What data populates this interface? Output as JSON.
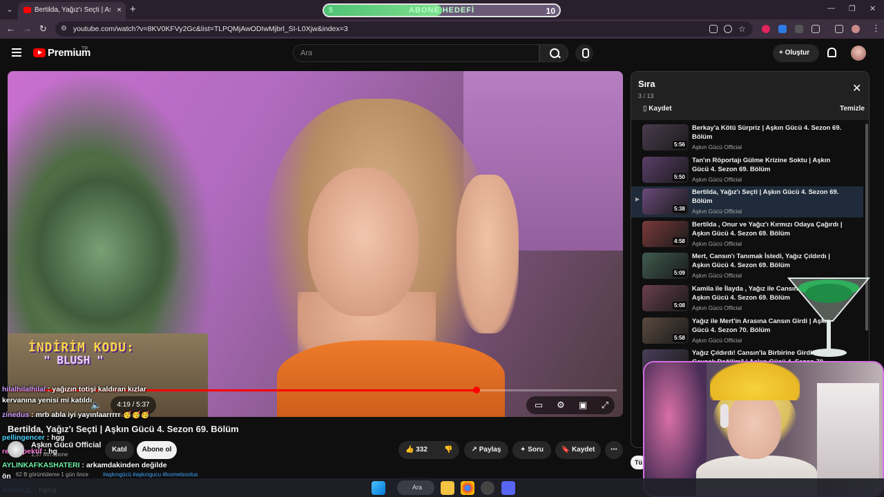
{
  "browser": {
    "tab_title": "Bertilda, Yağız'ı Seçti | Aşkın Gücü 4. Sezon 69. Bölüm",
    "url": "youtube.com/watch?v=8KV0KFVy2Gc&list=TLPQMjAwODIwMjbrl_SI-L0Xjw&index=3",
    "goal": {
      "left": "5",
      "label": "ABONE HEDEFİ",
      "right": "10",
      "progress_fraction": 0.5
    }
  },
  "header": {
    "brand": "Premium",
    "country": "TR",
    "search_placeholder": "Ara",
    "create_label": "Oluştur"
  },
  "video": {
    "promo_line1": "İNDİRİM KODU:",
    "promo_line2": "\" BLUSH \"",
    "time": "4:19 / 5:37",
    "progress_fraction": 0.77,
    "title": "Bertilda, Yağız'ı Seçti | Aşkın Gücü 4. Sezon 69. Bölüm",
    "channel": "Aşkın Gücü Official",
    "subs": "1,37 Mn abone",
    "join_label": "Katıl",
    "subscribe_label": "Abone ol",
    "likes": "332",
    "share_label": "Paylaş",
    "ask_label": "Soru",
    "save_label": "Kaydet",
    "desc_views": "62 B görüntüleme  1 gün önce",
    "desc_tags": "#aşkıngücü #aşkıngucu #kısmetsoolus"
  },
  "chat": [
    {
      "user": "hilalhilalhilal",
      "msg": "yağızın totişi kaldıran kızlar",
      "color": "#c99bff"
    },
    {
      "user": "",
      "msg": "kervanına yenisi mi katıldı",
      "color": "#ffffff"
    },
    {
      "user": "zinedus",
      "msg": "mrb abla iyi yayınlaarrrrr 🥳🥳🥳",
      "color": "#c99bff"
    },
    {
      "user": "pellingencer",
      "msg": "hgg",
      "color": "#4fd3ff"
    },
    {
      "user": "retrospektif",
      "msg": "hg",
      "color": "#ff7ad9"
    },
    {
      "user": "AYLINKAFKASHATERI",
      "msg": "arkamdakinden değilde",
      "color": "#6ff0a8"
    },
    {
      "user": "",
      "msg": "ön",
      "color": "#ffffff"
    },
    {
      "user": "BleibtQL",
      "msg": "hghg",
      "color": "#4fa0ff"
    }
  ],
  "playlist": {
    "title": "Sıra",
    "count": "3 / 13",
    "save_label": "Kaydet",
    "clear_label": "Temizle",
    "items": [
      {
        "title": "Berkay'a Kötü Sürpriz | Aşkın Gücü 4. Sezon 69. Bölüm",
        "channel": "Aşkın Gücü Official",
        "duration": "5:56",
        "thumb": "#4a3c4e"
      },
      {
        "title": "Tan'ın Röportajı Gülme Krizine Soktu | Aşkın Gücü 4. Sezon 69. Bölüm",
        "channel": "Aşkın Gücü Official",
        "duration": "5:50",
        "thumb": "#5b3f6a"
      },
      {
        "title": "Bertilda, Yağız'ı Seçti | Aşkın Gücü 4. Sezon 69. Bölüm",
        "channel": "Aşkın Gücü Official",
        "duration": "5:38",
        "thumb": "#6a4a7a"
      },
      {
        "title": "Bertilda , Onur ve Yağız'ı Kırmızı Odaya Çağırdı | Aşkın Gücü 4. Sezon 69. Bölüm",
        "channel": "Aşkın Gücü Official",
        "duration": "4:58",
        "thumb": "#7a3a3a"
      },
      {
        "title": "Mert, Cansın'ı Tanımak İstedi, Yağız Çıldırdı | Aşkın Gücü 4. Sezon 69. Bölüm",
        "channel": "Aşkın Gücü Official",
        "duration": "5:09",
        "thumb": "#3f5c50"
      },
      {
        "title": "Kamila ile İlayda , Yağız ile Cansın İçin Kavga | Aşkın Gücü 4. Sezon 69. Bölüm",
        "channel": "Aşkın Gücü Official",
        "duration": "5:08",
        "thumb": "#6a3f4e"
      },
      {
        "title": "Yağız ile Mert'in Arasına Cansın Girdi | Aşkın Gücü 4. Sezon 70. Bölüm",
        "channel": "Aşkın Gücü Official",
        "duration": "5:58",
        "thumb": "#5a4a3f"
      },
      {
        "title": "Yağız Çıldırdı! Cansın'la Birbirine Girdi \"Ben Gevşek Değilim\" | Aşkın Gücü 4. Sezon 70. Bölüm",
        "channel": "Aşkın Gücü Official",
        "duration": "",
        "thumb": "#4a3f5a"
      }
    ]
  },
  "side_btn_label": "Tü",
  "taskbar": {
    "search_label": "Ara"
  }
}
